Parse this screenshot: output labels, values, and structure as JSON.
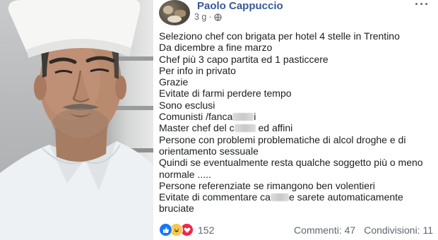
{
  "post": {
    "author": "Paolo Cappuccio",
    "time": "3 g",
    "separator": "·",
    "lines": [
      "Seleziono chef con brigata per hotel 4 stelle in Trentino",
      "Da dicembre a fine marzo",
      "Chef più 3 capo partita ed 1 pasticcere",
      "Per info in privato",
      "Grazie",
      "Evitate di farmi perdere tempo",
      "Sono esclusi"
    ],
    "redacted_line_1": {
      "before": "Comunisti /fanca",
      "after": "i"
    },
    "redacted_line_2": {
      "before": "Master chef del c",
      "after": " ed affini"
    },
    "lines_2": [
      "Persone con problemi problematiche di alcol droghe e di",
      "orientamento sessuale",
      "Quindi se eventualmente resta qualche soggetto più o meno",
      "normale .....",
      "Persone referenziate se rimangono ben volentieri"
    ],
    "redacted_line_3": {
      "before": "Evitate di commentare ca",
      "after": "e sarete automaticamente"
    },
    "last_line": "bruciate"
  },
  "footer": {
    "reaction_count": "152",
    "comments": "Commenti: 47",
    "shares": "Condivisioni: 11"
  },
  "icons": {
    "like": "thumbs-up-icon",
    "haha": "laughing-face-icon",
    "love": "heart-icon",
    "more": "more-options-icon",
    "audience": "globe-icon"
  },
  "colors": {
    "author_link": "#385898",
    "text": "#1c1e21",
    "muted": "#606770",
    "like_blue": "#1877f2",
    "haha_yellow": "#f7c84c",
    "love_red": "#f0284a"
  }
}
